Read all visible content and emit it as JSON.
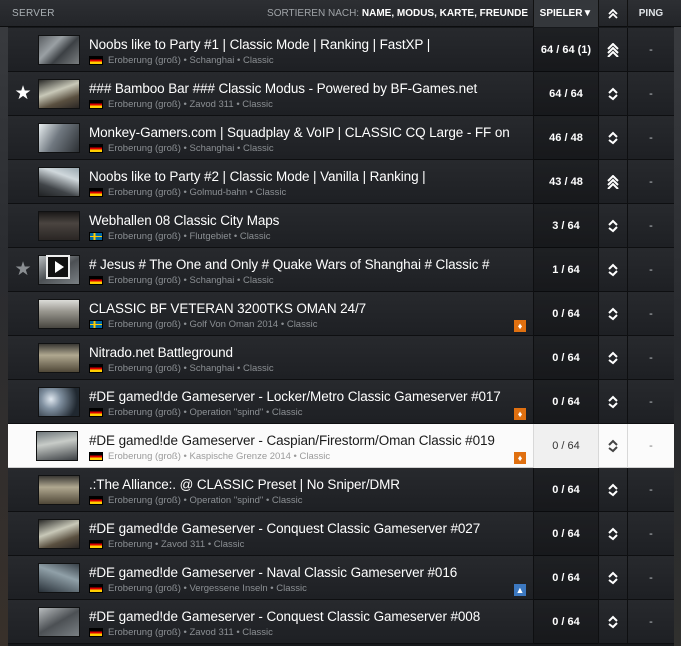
{
  "header": {
    "server_label": "SERVER",
    "sort_prefix": "SORTIEREN NACH:",
    "sort_options": "NAME, MODUS, KARTE, FREUNDE",
    "players_label": "SPIELER▼",
    "ping_label": "PING",
    "rank_icon": "rank-chevrons-icon"
  },
  "colors": {
    "selected_row": "#fbfbfb",
    "row_bg": "#23252a",
    "fire_icon": "#e07010",
    "image_icon": "#3c78c0"
  },
  "rows": [
    {
      "name": "Noobs like to Party #1 | Classic Mode | Ranking | FastXP |",
      "mode": "Eroberung (groß)",
      "map": "Schanghai",
      "preset": "Classic",
      "flag": "de",
      "players": "64 / 64 (1)",
      "ping": "-",
      "rank_icon": "rank-up-icon"
    },
    {
      "name": "### Bamboo Bar ### Classic Modus - Powered by BF-Games.net",
      "mode": "Eroberung (groß)",
      "map": "Zavod 311",
      "preset": "Classic",
      "flag": "de",
      "players": "64 / 64",
      "ping": "-",
      "rank_icon": "rank-swap-icon",
      "star": "★"
    },
    {
      "name": "Monkey-Gamers.com | Squadplay & VoIP | CLASSIC CQ Large - FF on",
      "mode": "Eroberung (groß)",
      "map": "Schanghai",
      "preset": "Classic",
      "flag": "de",
      "players": "46 / 48",
      "ping": "-",
      "rank_icon": "rank-swap-icon"
    },
    {
      "name": "Noobs like to Party #2 | Classic Mode | Vanilla | Ranking |",
      "mode": "Eroberung (groß)",
      "map": "Golmud-bahn",
      "preset": "Classic",
      "flag": "de",
      "players": "43 / 48",
      "ping": "-",
      "rank_icon": "rank-up-icon"
    },
    {
      "name": "Webhallen 08 Classic City Maps",
      "mode": "Eroberung (groß)",
      "map": "Flutgebiet",
      "preset": "Classic",
      "flag": "se",
      "players": "3 / 64",
      "ping": "-",
      "rank_icon": "rank-swap-icon"
    },
    {
      "name": "# Jesus # The One and Only # Quake Wars of Shanghai # Classic #",
      "mode": "Eroberung (groß)",
      "map": "Schanghai",
      "preset": "Classic",
      "flag": "de",
      "players": "1 / 64",
      "ping": "-",
      "rank_icon": "rank-swap-icon",
      "star": "★"
    },
    {
      "name": "CLASSIC BF VETERAN 3200TKS OMAN 24/7",
      "mode": "Eroberung (groß)",
      "map": "Golf Von Oman 2014",
      "preset": "Classic",
      "flag": "se",
      "players": "0 / 64",
      "ping": "-",
      "rank_icon": "rank-swap-icon",
      "badge": "fire-icon"
    },
    {
      "name": "Nitrado.net Battleground",
      "mode": "Eroberung (groß)",
      "map": "Schanghai",
      "preset": "Classic",
      "flag": "de",
      "players": "0 / 64",
      "ping": "-",
      "rank_icon": "rank-swap-icon"
    },
    {
      "name": "#DE gamed!de Gameserver - Locker/Metro Classic Gameserver #017",
      "mode": "Eroberung (groß)",
      "map": "Operation \"spind\"",
      "preset": "Classic",
      "flag": "de",
      "players": "0 / 64",
      "ping": "-",
      "rank_icon": "rank-swap-icon",
      "badge": "fire-icon"
    },
    {
      "name": "#DE gamed!de Gameserver - Caspian/Firestorm/Oman Classic #019",
      "mode": "Eroberung (groß)",
      "map": "Kaspische Grenze 2014",
      "preset": "Classic",
      "flag": "de",
      "players": "0 / 64",
      "ping": "-",
      "rank_icon": "rank-swap-icon",
      "badge": "fire-icon",
      "selected": true
    },
    {
      "name": ".:The Alliance:. @ CLASSIC Preset | No Sniper/DMR",
      "mode": "Eroberung (groß)",
      "map": "Operation \"spind\"",
      "preset": "Classic",
      "flag": "de",
      "players": "0 / 64",
      "ping": "-",
      "rank_icon": "rank-swap-icon"
    },
    {
      "name": "#DE gamed!de Gameserver - Conquest Classic Gameserver #027",
      "mode": "Eroberung",
      "map": "Zavod 311",
      "preset": "Classic",
      "flag": "de",
      "players": "0 / 64",
      "ping": "-",
      "rank_icon": "rank-swap-icon"
    },
    {
      "name": "#DE gamed!de Gameserver - Naval Classic Gameserver #016",
      "mode": "Eroberung (groß)",
      "map": "Vergessene Inseln",
      "preset": "Classic",
      "flag": "de",
      "players": "0 / 64",
      "ping": "-",
      "rank_icon": "rank-swap-icon",
      "badge": "image-icon"
    },
    {
      "name": "#DE gamed!de Gameserver - Conquest Classic Gameserver #008",
      "mode": "Eroberung (groß)",
      "map": "Zavod 311",
      "preset": "Classic",
      "flag": "de",
      "players": "0 / 64",
      "ping": "-",
      "rank_icon": "rank-swap-icon"
    }
  ]
}
